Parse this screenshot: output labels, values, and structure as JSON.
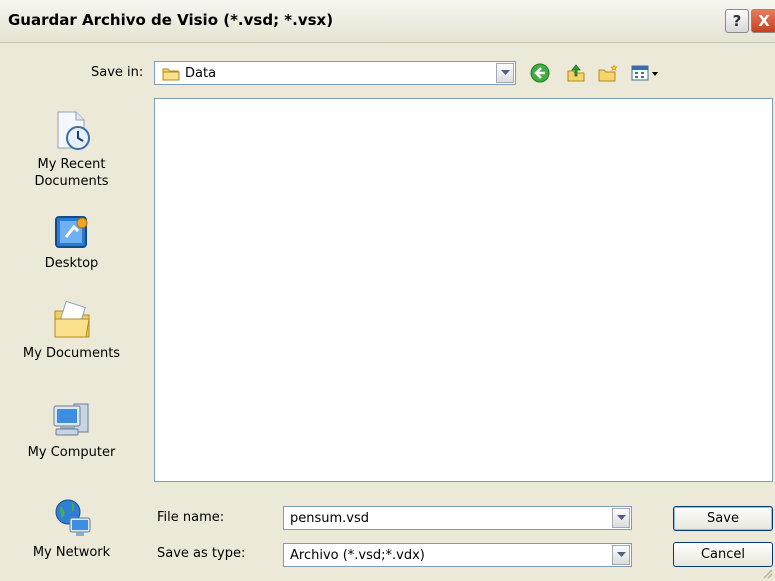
{
  "window": {
    "title": "Guardar Archivo de Visio  (*.vsd; *.vsx)",
    "help_label": "?",
    "close_label": "X"
  },
  "toolbar": {
    "save_in_label": "Save in:",
    "save_in_value": "Data",
    "icons": [
      "folder-icon",
      "back-icon",
      "up-folder-icon",
      "new-folder-icon",
      "views-menu-icon"
    ]
  },
  "places": [
    {
      "label_line1": "My Recent",
      "label_line2": "Documents",
      "icon": "recent-documents-icon"
    },
    {
      "label_line1": "Desktop",
      "label_line2": "",
      "icon": "desktop-icon"
    },
    {
      "label_line1": "My Documents",
      "label_line2": "",
      "icon": "my-documents-icon"
    },
    {
      "label_line1": "My Computer",
      "label_line2": "",
      "icon": "my-computer-icon"
    },
    {
      "label_line1": "My Network",
      "label_line2": "",
      "icon": "my-network-icon"
    }
  ],
  "form": {
    "file_name_label": "File name:",
    "file_name_value": "pensum.vsd",
    "save_as_type_label": "Save as type:",
    "save_as_type_value": "Archivo (*.vsd;*.vdx)"
  },
  "buttons": {
    "save": "Save",
    "cancel": "Cancel"
  },
  "colors": {
    "dialog_bg": "#ece9d8",
    "list_border": "#7f9db9",
    "close_red": "#c6401f"
  }
}
